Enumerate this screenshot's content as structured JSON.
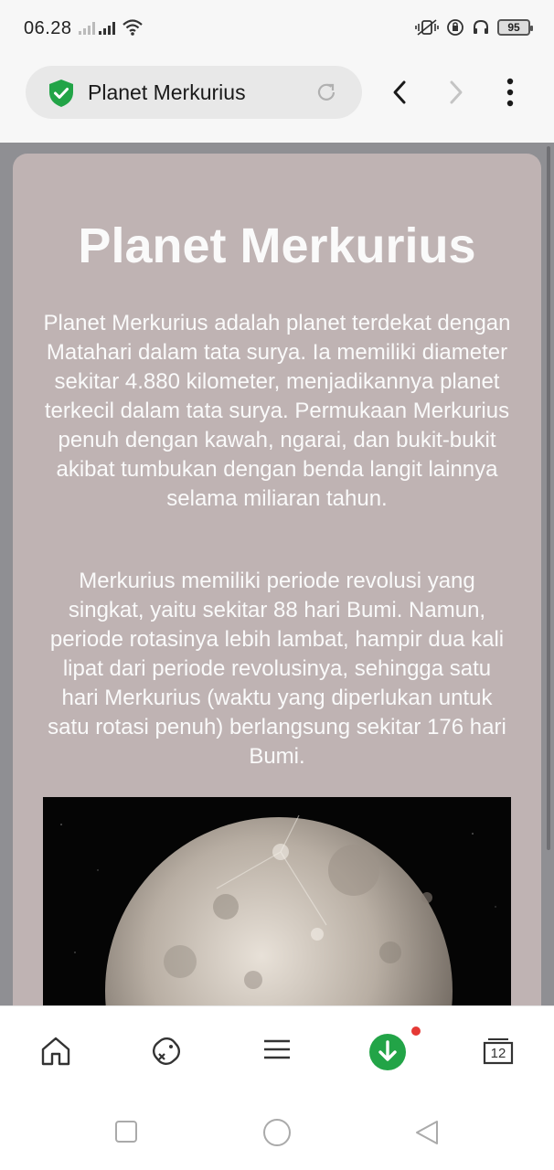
{
  "status_bar": {
    "time": "06.28",
    "battery": "95"
  },
  "browser": {
    "tab_title": "Planet Merkurius",
    "accent_color": "#22a447"
  },
  "article": {
    "title": "Planet Merkurius",
    "paragraph1": "Planet Merkurius adalah planet terdekat dengan Matahari dalam tata surya. Ia memiliki diameter sekitar 4.880 kilometer, menjadikannya planet terkecil dalam tata surya. Permukaan Merkurius penuh dengan kawah, ngarai, dan bukit-bukit akibat tumbukan dengan benda langit lainnya selama miliaran tahun.",
    "paragraph2": "Merkurius memiliki periode revolusi yang singkat, yaitu sekitar 88 hari Bumi. Namun, periode rotasinya lebih lambat, hampir dua kali lipat dari periode revolusinya, sehingga satu hari Merkurius (waktu yang diperlukan untuk satu rotasi penuh) berlangsung sekitar 176 hari Bumi.",
    "card_color": "#bfb3b3"
  },
  "bottom_nav": {
    "tabs_count": "12",
    "icons": [
      "home-icon",
      "game-controller-icon",
      "menu-icon",
      "download-icon",
      "tabs-icon"
    ]
  }
}
